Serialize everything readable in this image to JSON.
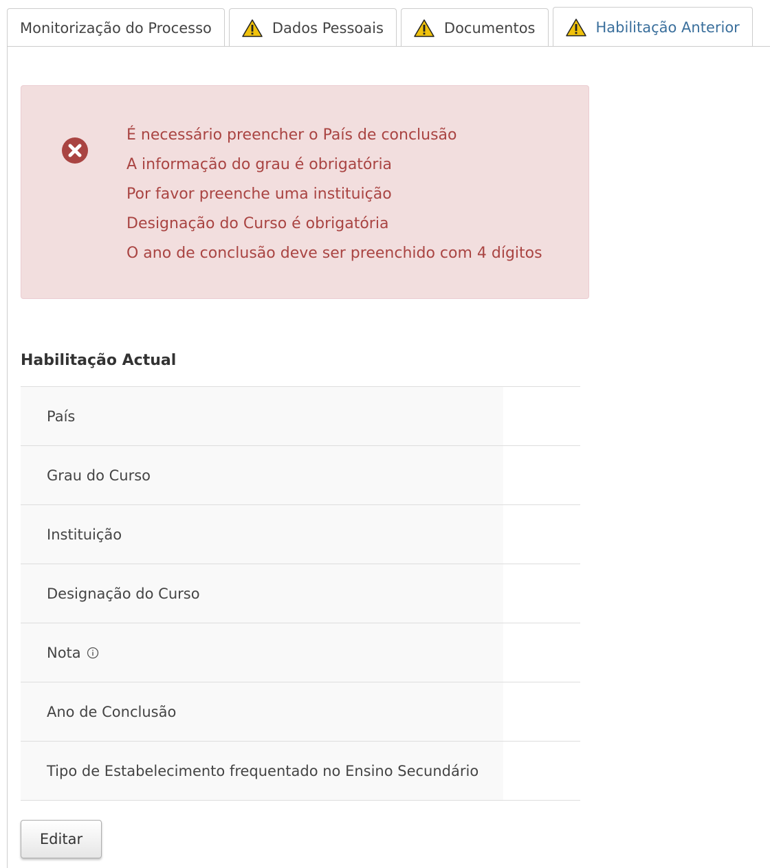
{
  "tabs": [
    {
      "label": "Monitorização do Processo",
      "warning": false
    },
    {
      "label": "Dados Pessoais",
      "warning": true
    },
    {
      "label": "Documentos",
      "warning": true
    },
    {
      "label": "Habilitação Anterior",
      "warning": true,
      "active": true
    }
  ],
  "alert": {
    "messages": [
      "É necessário preencher o País de conclusão",
      "A informação do grau é obrigatória",
      "Por favor preenche uma instituição",
      "Designação do Curso é obrigatória",
      "O ano de conclusão deve ser preenchido com 4 dígitos"
    ]
  },
  "section": {
    "title": "Habilitação Actual",
    "rows": [
      {
        "label": "País",
        "value": ""
      },
      {
        "label": "Grau do Curso",
        "value": ""
      },
      {
        "label": "Instituição",
        "value": ""
      },
      {
        "label": "Designação do Curso",
        "value": ""
      },
      {
        "label": "Nota",
        "value": ""
      },
      {
        "label": "Ano de Conclusão",
        "value": ""
      },
      {
        "label": "Tipo de Estabelecimento frequentado no Ensino Secundário",
        "value": ""
      }
    ]
  },
  "buttons": {
    "edit_label": "Editar"
  },
  "colors": {
    "alert_bg": "#f2dede",
    "alert_text": "#a94442",
    "active_tab": "#3a6f9c",
    "warning": "#f0c20c"
  }
}
